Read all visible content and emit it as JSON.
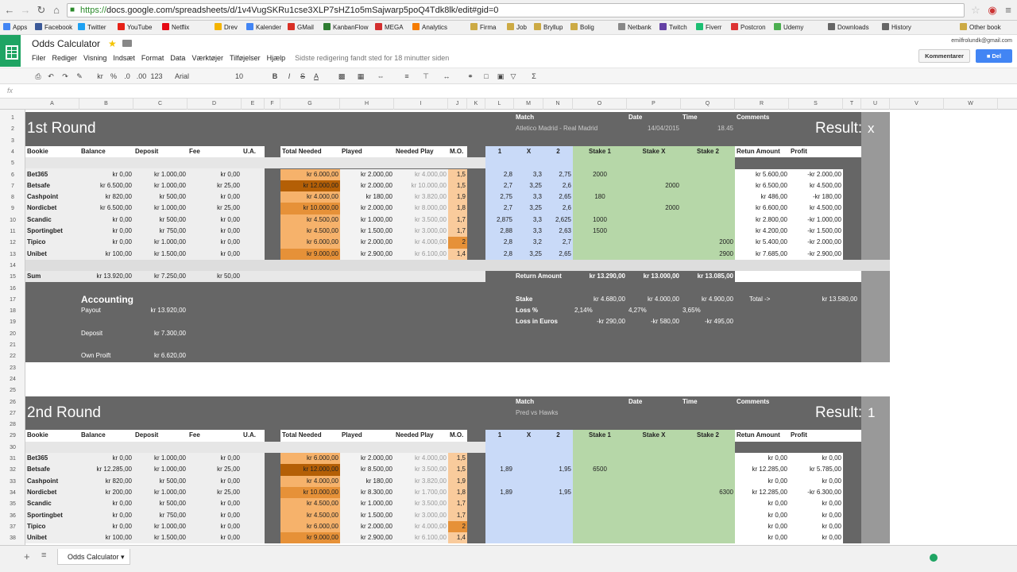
{
  "browser": {
    "url_scheme": "https://",
    "url_rest": "docs.google.com/spreadsheets/d/1v4VugSKRu1cse3XLP7sHZ1o5mSajwarp5poQ4Tdk8lk/edit#gid=0",
    "bookmarks": [
      "Apps",
      "Facebook",
      "Twitter",
      "YouTube",
      "Netflix",
      "Drev",
      "Kalender",
      "GMail",
      "KanbanFlow",
      "MEGA",
      "Analytics",
      "Firma",
      "Job",
      "Bryllup",
      "Bolig",
      "Netbank",
      "Twitch",
      "Fiverr",
      "Postcron",
      "Udemy",
      "Downloads",
      "History",
      "Other book"
    ]
  },
  "app": {
    "title": "Odds Calculator",
    "menu": [
      "Filer",
      "Rediger",
      "Visning",
      "Indsæt",
      "Format",
      "Data",
      "Værktøjer",
      "Tilføjelser",
      "Hjælp"
    ],
    "last_edit": "Sidste redigering fandt sted for 18 minutter siden",
    "user": "emilfrolundk@gmail.com",
    "comments_label": "Kommentarer",
    "share_label": "Del",
    "font": "Arial",
    "font_size": "10",
    "sheet_tab": "Odds Calculator"
  },
  "columns": [
    "A",
    "B",
    "C",
    "D",
    "E",
    "F",
    "G",
    "H",
    "I",
    "J",
    "K",
    "L",
    "M",
    "N",
    "O",
    "P",
    "Q",
    "R",
    "S",
    "T",
    "U",
    "V",
    "W"
  ],
  "rows": [
    "1",
    "2",
    "3",
    "4",
    "5",
    "6",
    "7",
    "8",
    "9",
    "10",
    "11",
    "12",
    "13",
    "14",
    "15",
    "16",
    "17",
    "18",
    "19",
    "20",
    "21",
    "22",
    "23",
    "24",
    "25",
    "26",
    "27",
    "28",
    "29",
    "30",
    "31",
    "32",
    "33",
    "34",
    "35",
    "36",
    "37",
    "38"
  ],
  "headers": {
    "bookie": "Bookie",
    "balance": "Balance",
    "deposit": "Deposit",
    "fee": "Fee",
    "ua": "U.A.",
    "total_needed": "Total Needed",
    "played": "Played",
    "needed_play": "Needed Play",
    "mo": "M.O.",
    "o1": "1",
    "ox": "X",
    "o2": "2",
    "s1": "Stake 1",
    "sx": "Stake X",
    "s2": "Stake 2",
    "ret": "Retun Amount",
    "profit": "Profit",
    "match": "Match",
    "date": "Date",
    "time": "Time",
    "comments": "Comments",
    "result": "Result:"
  },
  "round1": {
    "title": "1st Round",
    "match": "Atletico Madrid - Real Madrid",
    "date": "14/04/2015",
    "time": "18.45",
    "result": "x",
    "bookies": [
      {
        "name": "Bet365",
        "balance": "kr 0,00",
        "deposit": "kr 1.000,00",
        "fee": "kr 0,00",
        "total": "kr 6.000,00",
        "played": "kr 2.000,00",
        "needed": "kr 4.000,00",
        "mo": "1,5",
        "o1": "2,8",
        "ox": "3,3",
        "o2": "2,75",
        "s1": "2000",
        "sx": "",
        "s2": "",
        "ret": "kr 5.600,00",
        "profit": "-kr 2.000,00"
      },
      {
        "name": "Betsafe",
        "balance": "kr 6.500,00",
        "deposit": "kr 1.000,00",
        "fee": "kr 25,00",
        "total": "kr 12.000,00",
        "played": "kr 2.000,00",
        "needed": "kr 10.000,00",
        "mo": "1,5",
        "o1": "2,7",
        "ox": "3,25",
        "o2": "2,6",
        "s1": "",
        "sx": "2000",
        "s2": "",
        "ret": "kr 6.500,00",
        "profit": "kr 4.500,00"
      },
      {
        "name": "Cashpoint",
        "balance": "kr 820,00",
        "deposit": "kr 500,00",
        "fee": "kr 0,00",
        "total": "kr 4.000,00",
        "played": "kr 180,00",
        "needed": "kr 3.820,00",
        "mo": "1,9",
        "o1": "2,75",
        "ox": "3,3",
        "o2": "2,65",
        "s1": "180",
        "sx": "",
        "s2": "",
        "ret": "kr 486,00",
        "profit": "-kr 180,00"
      },
      {
        "name": "Nordicbet",
        "balance": "kr 6.500,00",
        "deposit": "kr 1.000,00",
        "fee": "kr 25,00",
        "total": "kr 10.000,00",
        "played": "kr 2.000,00",
        "needed": "kr 8.000,00",
        "mo": "1,8",
        "o1": "2,7",
        "ox": "3,25",
        "o2": "2,6",
        "s1": "",
        "sx": "2000",
        "s2": "",
        "ret": "kr 6.600,00",
        "profit": "kr 4.500,00"
      },
      {
        "name": "Scandic",
        "balance": "kr 0,00",
        "deposit": "kr 500,00",
        "fee": "kr 0,00",
        "total": "kr 4.500,00",
        "played": "kr 1.000,00",
        "needed": "kr 3.500,00",
        "mo": "1,7",
        "o1": "2,875",
        "ox": "3,3",
        "o2": "2,625",
        "s1": "1000",
        "sx": "",
        "s2": "",
        "ret": "kr 2.800,00",
        "profit": "-kr 1.000,00"
      },
      {
        "name": "Sportingbet",
        "balance": "kr 0,00",
        "deposit": "kr 750,00",
        "fee": "kr 0,00",
        "total": "kr 4.500,00",
        "played": "kr 1.500,00",
        "needed": "kr 3.000,00",
        "mo": "1,7",
        "o1": "2,88",
        "ox": "3,3",
        "o2": "2,63",
        "s1": "1500",
        "sx": "",
        "s2": "",
        "ret": "kr 4.200,00",
        "profit": "-kr 1.500,00"
      },
      {
        "name": "Tipico",
        "balance": "kr 0,00",
        "deposit": "kr 1.000,00",
        "fee": "kr 0,00",
        "total": "kr 6.000,00",
        "played": "kr 2.000,00",
        "needed": "kr 4.000,00",
        "mo": "2",
        "o1": "2,8",
        "ox": "3,2",
        "o2": "2,7",
        "s1": "",
        "sx": "",
        "s2": "2000",
        "ret": "kr 5.400,00",
        "profit": "-kr 2.000,00"
      },
      {
        "name": "Unibet",
        "balance": "kr 100,00",
        "deposit": "kr 1.500,00",
        "fee": "kr 0,00",
        "total": "kr 9.000,00",
        "played": "kr 2.900,00",
        "needed": "kr 6.100,00",
        "mo": "1,4",
        "o1": "2,8",
        "ox": "3,25",
        "o2": "2,65",
        "s1": "",
        "sx": "",
        "s2": "2900",
        "ret": "kr 7.685,00",
        "profit": "-kr 2.900,00"
      }
    ],
    "sum_label": "Sum",
    "sum_balance": "kr 13.920,00",
    "sum_deposit": "kr 7.250,00",
    "sum_fee": "kr 50,00",
    "return_label": "Return Amount",
    "ret1": "kr 13.290,00",
    "retx": "kr 13.000,00",
    "ret2": "kr 13.085,00",
    "accounting": "Accounting",
    "payout_label": "Payout",
    "payout": "kr 13.920,00",
    "deposit_label": "Deposit",
    "deposit": "kr 7.300,00",
    "own_label": "Own Proift",
    "own": "kr 6.620,00",
    "stake_label": "Stake",
    "stake1": "kr 4.680,00",
    "stakex": "kr 4.000,00",
    "stake2": "kr 4.900,00",
    "total_label": "Total ->",
    "total": "kr 13.580,00",
    "loss_pct_label": "Loss %",
    "loss1": "2,14%",
    "lossx": "4,27%",
    "loss2": "3,65%",
    "loss_eur_label": "Loss in Euros",
    "le1": "-kr 290,00",
    "lex": "-kr 580,00",
    "le2": "-kr 495,00"
  },
  "round2": {
    "title": "2nd Round",
    "match": "Pred vs Hawks",
    "date": "",
    "time": "",
    "result": "1",
    "bookies": [
      {
        "name": "Bet365",
        "balance": "kr 0,00",
        "deposit": "kr 1.000,00",
        "fee": "kr 0,00",
        "total": "kr 6.000,00",
        "played": "kr 2.000,00",
        "needed": "kr 4.000,00",
        "mo": "1,5",
        "o1": "",
        "ox": "",
        "o2": "",
        "s1": "",
        "sx": "",
        "s2": "",
        "ret": "kr 0,00",
        "profit": "kr 0,00"
      },
      {
        "name": "Betsafe",
        "balance": "kr 12.285,00",
        "deposit": "kr 1.000,00",
        "fee": "kr 25,00",
        "total": "kr 12.000,00",
        "played": "kr 8.500,00",
        "needed": "kr 3.500,00",
        "mo": "1,5",
        "o1": "1,89",
        "ox": "",
        "o2": "1,95",
        "s1": "6500",
        "sx": "",
        "s2": "",
        "ret": "kr 12.285,00",
        "profit": "kr 5.785,00"
      },
      {
        "name": "Cashpoint",
        "balance": "kr 820,00",
        "deposit": "kr 500,00",
        "fee": "kr 0,00",
        "total": "kr 4.000,00",
        "played": "kr 180,00",
        "needed": "kr 3.820,00",
        "mo": "1,9",
        "o1": "",
        "ox": "",
        "o2": "",
        "s1": "",
        "sx": "",
        "s2": "",
        "ret": "kr 0,00",
        "profit": "kr 0,00"
      },
      {
        "name": "Nordicbet",
        "balance": "kr 200,00",
        "deposit": "kr 1.000,00",
        "fee": "kr 25,00",
        "total": "kr 10.000,00",
        "played": "kr 8.300,00",
        "needed": "kr 1.700,00",
        "mo": "1,8",
        "o1": "1,89",
        "ox": "",
        "o2": "1,95",
        "s1": "",
        "sx": "",
        "s2": "6300",
        "ret": "kr 12.285,00",
        "profit": "-kr 6.300,00"
      },
      {
        "name": "Scandic",
        "balance": "kr 0,00",
        "deposit": "kr 500,00",
        "fee": "kr 0,00",
        "total": "kr 4.500,00",
        "played": "kr 1.000,00",
        "needed": "kr 3.500,00",
        "mo": "1,7",
        "o1": "",
        "ox": "",
        "o2": "",
        "s1": "",
        "sx": "",
        "s2": "",
        "ret": "kr 0,00",
        "profit": "kr 0,00"
      },
      {
        "name": "Sportingbet",
        "balance": "kr 0,00",
        "deposit": "kr 750,00",
        "fee": "kr 0,00",
        "total": "kr 4.500,00",
        "played": "kr 1.500,00",
        "needed": "kr 3.000,00",
        "mo": "1,7",
        "o1": "",
        "ox": "",
        "o2": "",
        "s1": "",
        "sx": "",
        "s2": "",
        "ret": "kr 0,00",
        "profit": "kr 0,00"
      },
      {
        "name": "Tipico",
        "balance": "kr 0,00",
        "deposit": "kr 1.000,00",
        "fee": "kr 0,00",
        "total": "kr 6.000,00",
        "played": "kr 2.000,00",
        "needed": "kr 4.000,00",
        "mo": "2",
        "o1": "",
        "ox": "",
        "o2": "",
        "s1": "",
        "sx": "",
        "s2": "",
        "ret": "kr 0,00",
        "profit": "kr 0,00"
      },
      {
        "name": "Unibet",
        "balance": "kr 100,00",
        "deposit": "kr 1.500,00",
        "fee": "kr 0,00",
        "total": "kr 9.000,00",
        "played": "kr 2.900,00",
        "needed": "kr 6.100,00",
        "mo": "1,4",
        "o1": "",
        "ox": "",
        "o2": "",
        "s1": "",
        "sx": "",
        "s2": "",
        "ret": "kr 0,00",
        "profit": "kr 0,00"
      }
    ]
  },
  "colors": {
    "dark": "#666666",
    "header_row": "#ffffff",
    "orange_light": "#f6b26b",
    "orange_dark": "#e69138",
    "blue": "#c9daf8",
    "green": "#b6d7a8",
    "purple_gray": "#d9d2e9"
  }
}
